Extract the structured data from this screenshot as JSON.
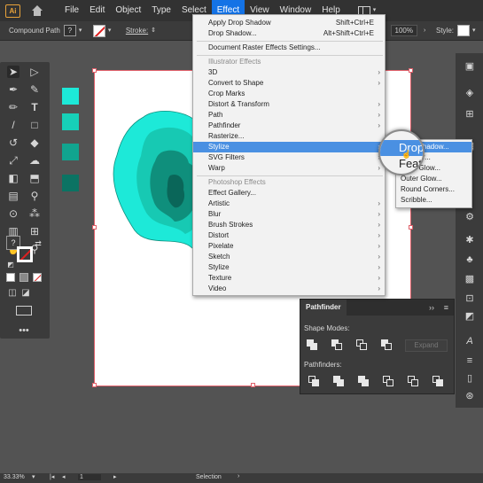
{
  "app": {
    "logo": "Ai"
  },
  "menubar": {
    "items": [
      "File",
      "Edit",
      "Object",
      "Type",
      "Select",
      "Effect",
      "View",
      "Window",
      "Help"
    ],
    "active": "Effect"
  },
  "controlbar": {
    "compound_path": "Compound Path",
    "fill_q": "?",
    "stroke_label": "Stroke:",
    "opacity": "100%",
    "style_label": "Style:"
  },
  "effect_menu": {
    "apply_last": {
      "label": "Apply Drop Shadow",
      "shortcut": "Shift+Ctrl+E"
    },
    "last_effect": {
      "label": "Drop Shadow...",
      "shortcut": "Alt+Shift+Ctrl+E"
    },
    "raster_settings": "Document Raster Effects Settings...",
    "illustrator_header": "Illustrator Effects",
    "illustrator_items": [
      "3D",
      "Convert to Shape",
      "Crop Marks",
      "Distort & Transform",
      "Path",
      "Pathfinder",
      "Rasterize...",
      "Stylize",
      "SVG Filters",
      "Warp"
    ],
    "photoshop_header": "Photoshop Effects",
    "photoshop_items": [
      "Effect Gallery...",
      "Artistic",
      "Blur",
      "Brush Strokes",
      "Distort",
      "Pixelate",
      "Sketch",
      "Stylize",
      "Texture",
      "Video"
    ],
    "highlighted": "Stylize"
  },
  "stylize_submenu": {
    "items": [
      "Drop Shadow...",
      "Feather...",
      "Inner Glow...",
      "Outer Glow...",
      "Round Corners...",
      "Scribble..."
    ],
    "highlighted": "Drop Shadow..."
  },
  "lens": {
    "line1": "Drop",
    "line2": "Feat"
  },
  "pathfinder": {
    "tab": "Pathfinder",
    "shape_modes_label": "Shape Modes:",
    "expand_label": "Expand",
    "pathfinders_label": "Pathfinders:"
  },
  "statusbar": {
    "zoom": "33.33%",
    "artboard": "1",
    "tool": "Selection"
  },
  "colors": {
    "accent": "#1473e6",
    "swatches": [
      "#1de9d8",
      "#17d0b8",
      "#11a48f",
      "#0b7363"
    ],
    "shape_light": "#1de9d8",
    "shape_mid": "#17c9b3",
    "shape_dark": "#0f8f7c",
    "shape_darkest": "#0a6659"
  }
}
